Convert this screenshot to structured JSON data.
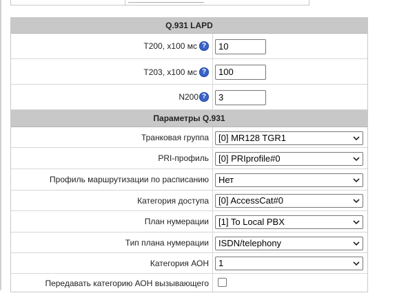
{
  "q931_lapd": {
    "title": "Q.931 LAPD",
    "t200": {
      "label": "T200, x100 мс",
      "value": "10"
    },
    "t203": {
      "label": "T203, x100 мс",
      "value": "100"
    },
    "n200": {
      "label": "N200",
      "value": "3"
    }
  },
  "q931_params": {
    "title": "Параметры Q.931",
    "trunk_group": {
      "label": "Транковая группа",
      "value": "[0] MR128 TGR1"
    },
    "pri_profile": {
      "label": "PRI-профиль",
      "value": "[0] PRIprofile#0"
    },
    "schedule_routing_profile": {
      "label": "Профиль маршрутизации по расписанию",
      "value": "Нет"
    },
    "access_category": {
      "label": "Категория доступа",
      "value": "[0] AccessCat#0"
    },
    "numbering_plan": {
      "label": "План нумерации",
      "value": "[1] To Local PBX"
    },
    "numbering_plan_type": {
      "label": "Тип плана нумерации",
      "value": "ISDN/telephony"
    },
    "aon_category": {
      "label": "Категория АОН",
      "value": "1"
    },
    "transmit_aon_category": {
      "label": "Передавать категорию АОН вызывающего",
      "checked": false
    }
  },
  "icons": {
    "help": "help-icon",
    "dropdown": "chevron-down-icon"
  },
  "colors": {
    "header_bg": "#c8c8c8",
    "help_icon": "#3a64c8",
    "border": "#d6d6d6"
  }
}
